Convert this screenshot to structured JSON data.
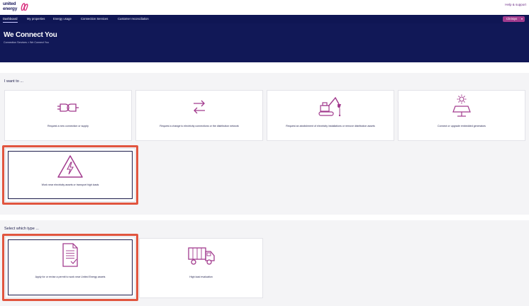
{
  "header": {
    "logo_line1": "united",
    "logo_line2": "energy",
    "help_link": "Help & support"
  },
  "nav": {
    "items": [
      "Dashboard",
      "My properties",
      "Energy usage",
      "Connection Services",
      "Customer reconciliation"
    ],
    "user_label": "Christyn"
  },
  "hero": {
    "title": "We Connect You",
    "breadcrumb": "Connection Services > We Connect You"
  },
  "section1": {
    "title": "I want to ...",
    "cards": [
      {
        "label": "Request a new connection or supply",
        "icon": "plug-icon"
      },
      {
        "label": "Request a change to electricity connections or the distribution network",
        "icon": "swap-arrows-icon"
      },
      {
        "label": "Request an abolishment of electricity installations or remove distribution assets",
        "icon": "excavator-icon"
      },
      {
        "label": "Connect or upgrade embedded generators",
        "icon": "solar-panel-icon"
      },
      {
        "label": "Work near electricity assets or transport high loads",
        "icon": "high-voltage-icon"
      }
    ]
  },
  "section2": {
    "title": "Select which type ...",
    "cards": [
      {
        "label": "Apply for or revise a permit to work near United Energy assets",
        "icon": "document-icon"
      },
      {
        "label": "High load evaluation",
        "icon": "truck-icon"
      }
    ]
  },
  "colors": {
    "navy": "#0f1654",
    "accent": "#a23b8e",
    "highlight": "#e1553f"
  }
}
